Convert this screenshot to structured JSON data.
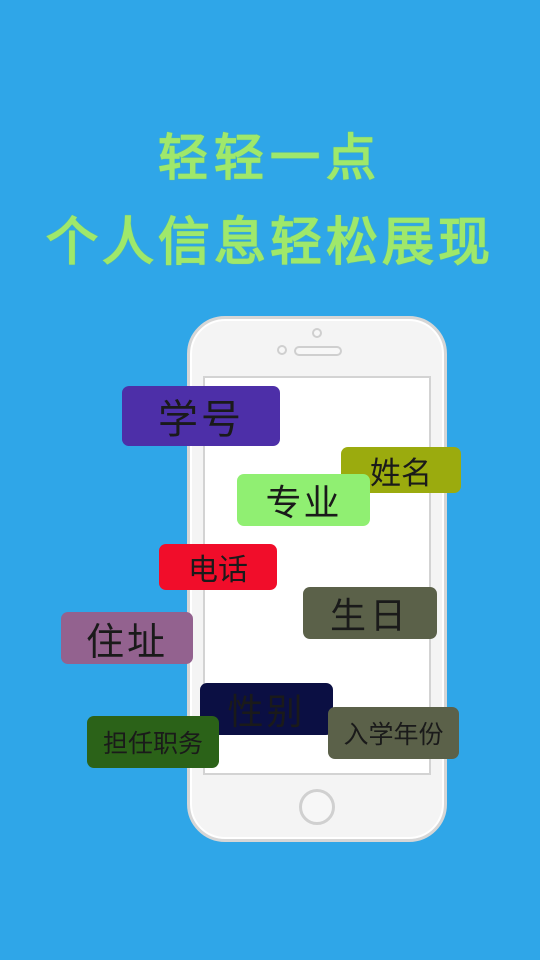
{
  "headline": {
    "line1": "轻轻一点",
    "line2": "个人信息轻松展现"
  },
  "tags": {
    "xuehao": "学号",
    "xingming": "姓名",
    "zhuanye": "专业",
    "dianhua": "电话",
    "shengri": "生日",
    "zhuzhi": "住址",
    "xingbie": "性别",
    "ruxue": "入学年份",
    "danren": "担任职务"
  },
  "colors": {
    "background": "#2fa6e8",
    "headline": "#9fe86b"
  }
}
